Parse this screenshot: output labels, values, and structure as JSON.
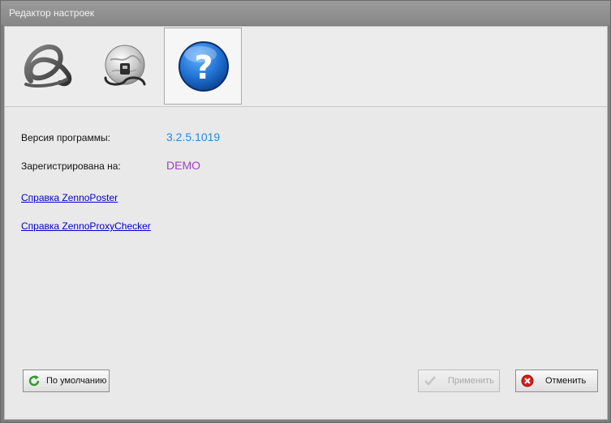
{
  "window": {
    "title": "Редактор настроек"
  },
  "toolbar": {
    "items": [
      {
        "icon": "knot-icon",
        "selected": false
      },
      {
        "icon": "network-globe-icon",
        "selected": false
      },
      {
        "icon": "help-question-icon",
        "selected": true
      }
    ]
  },
  "about": {
    "version_label": "Версия программы:",
    "version_value": "3.2.5.1019",
    "registered_label": "Зарегистрирована на:",
    "registered_value": "DEMO",
    "link_zennoposter": "Справка ZennoPoster",
    "link_proxychecker": "Справка ZennoProxyChecker"
  },
  "buttons": {
    "defaults": "По умолчанию",
    "apply": "Применить",
    "cancel": "Отменить"
  },
  "colors": {
    "version_value": "#2a88d8",
    "registered_value": "#a23fc1",
    "link": "#0000cc"
  }
}
